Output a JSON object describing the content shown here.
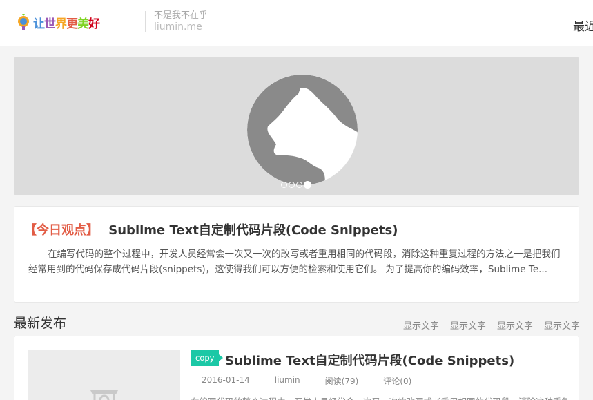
{
  "header": {
    "logo_text": "让世界更美好",
    "slogan": "不是我不在乎",
    "domain": "liumin.me",
    "nav_recent": "最近"
  },
  "banner": {
    "slides": 4,
    "active_slide": 4
  },
  "featured": {
    "tag": "【今日观点】",
    "title": "Sublime Text自定制代码片段(Code Snippets)",
    "excerpt": "在编写代码的整个过程中，开发人员经常会一次又一次的改写或者重用相同的代码段，消除这种重复过程的方法之一是把我们经常用到的代码保存成代码片段(snippets)，这使得我们可以方便的检索和使用它们。 为了提高你的编码效率，Sublime Te..."
  },
  "latest": {
    "title": "最新发布",
    "links": [
      "显示文字",
      "显示文字",
      "显示文字",
      "显示文字"
    ]
  },
  "post": {
    "badge": "copy",
    "title": "Sublime Text自定制代码片段(Code Snippets)",
    "date": "2016-01-14",
    "author": "liumin",
    "reads": "阅读(79)",
    "comments": "评论(0)",
    "excerpt": "在编写代码的整个过程中，开发人员经常会一次又一次的改写或者重用相同的代码段，消除这种重复过"
  },
  "colors": {
    "accent_red": "#e25c45",
    "badge_green": "#1bc8a6",
    "banner_bg": "#dcdcdc"
  }
}
